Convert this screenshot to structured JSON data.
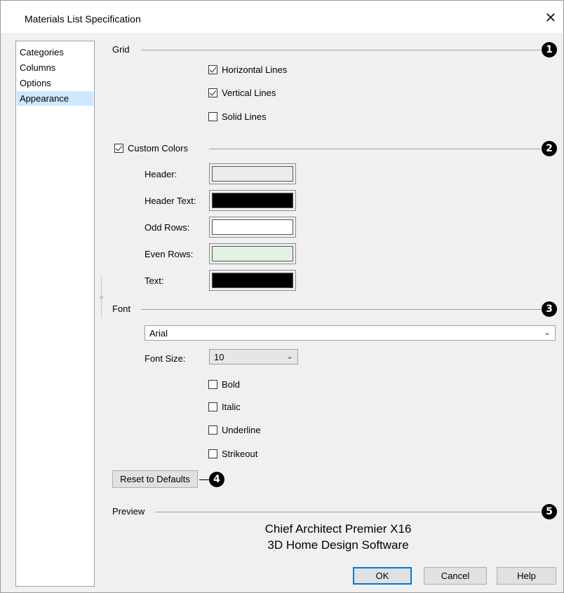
{
  "window": {
    "title": "Materials List Specification"
  },
  "nav": {
    "items": [
      "Categories",
      "Columns",
      "Options",
      "Appearance"
    ],
    "selected": "Appearance"
  },
  "grid": {
    "label": "Grid",
    "badge": "1",
    "horizontal_lines": {
      "label": "Horizontal Lines",
      "checked": true
    },
    "vertical_lines": {
      "label": "Vertical Lines",
      "checked": true
    },
    "solid_lines": {
      "label": "Solid Lines",
      "checked": false
    }
  },
  "colors": {
    "label": "Custom Colors",
    "checked": true,
    "badge": "2",
    "header": {
      "label": "Header:",
      "color": "#ececec"
    },
    "header_text": {
      "label": "Header Text:",
      "color": "#000000"
    },
    "odd_rows": {
      "label": "Odd Rows:",
      "color": "#ffffff"
    },
    "even_rows": {
      "label": "Even Rows:",
      "color": "#e3f3e3"
    },
    "text": {
      "label": "Text:",
      "color": "#000000"
    }
  },
  "font": {
    "label": "Font",
    "badge": "3",
    "family": "Arial",
    "size_label": "Font Size:",
    "size": "10",
    "bold": {
      "label": "Bold",
      "checked": false
    },
    "italic": {
      "label": "Italic",
      "checked": false
    },
    "underline": {
      "label": "Underline",
      "checked": false
    },
    "strikeout": {
      "label": "Strikeout",
      "checked": false
    }
  },
  "reset": {
    "label": "Reset to Defaults",
    "badge": "4"
  },
  "preview": {
    "label": "Preview",
    "badge": "5",
    "line1": "Chief Architect Premier X16",
    "line2": "3D Home Design Software"
  },
  "footer": {
    "ok": "OK",
    "cancel": "Cancel",
    "help": "Help"
  }
}
